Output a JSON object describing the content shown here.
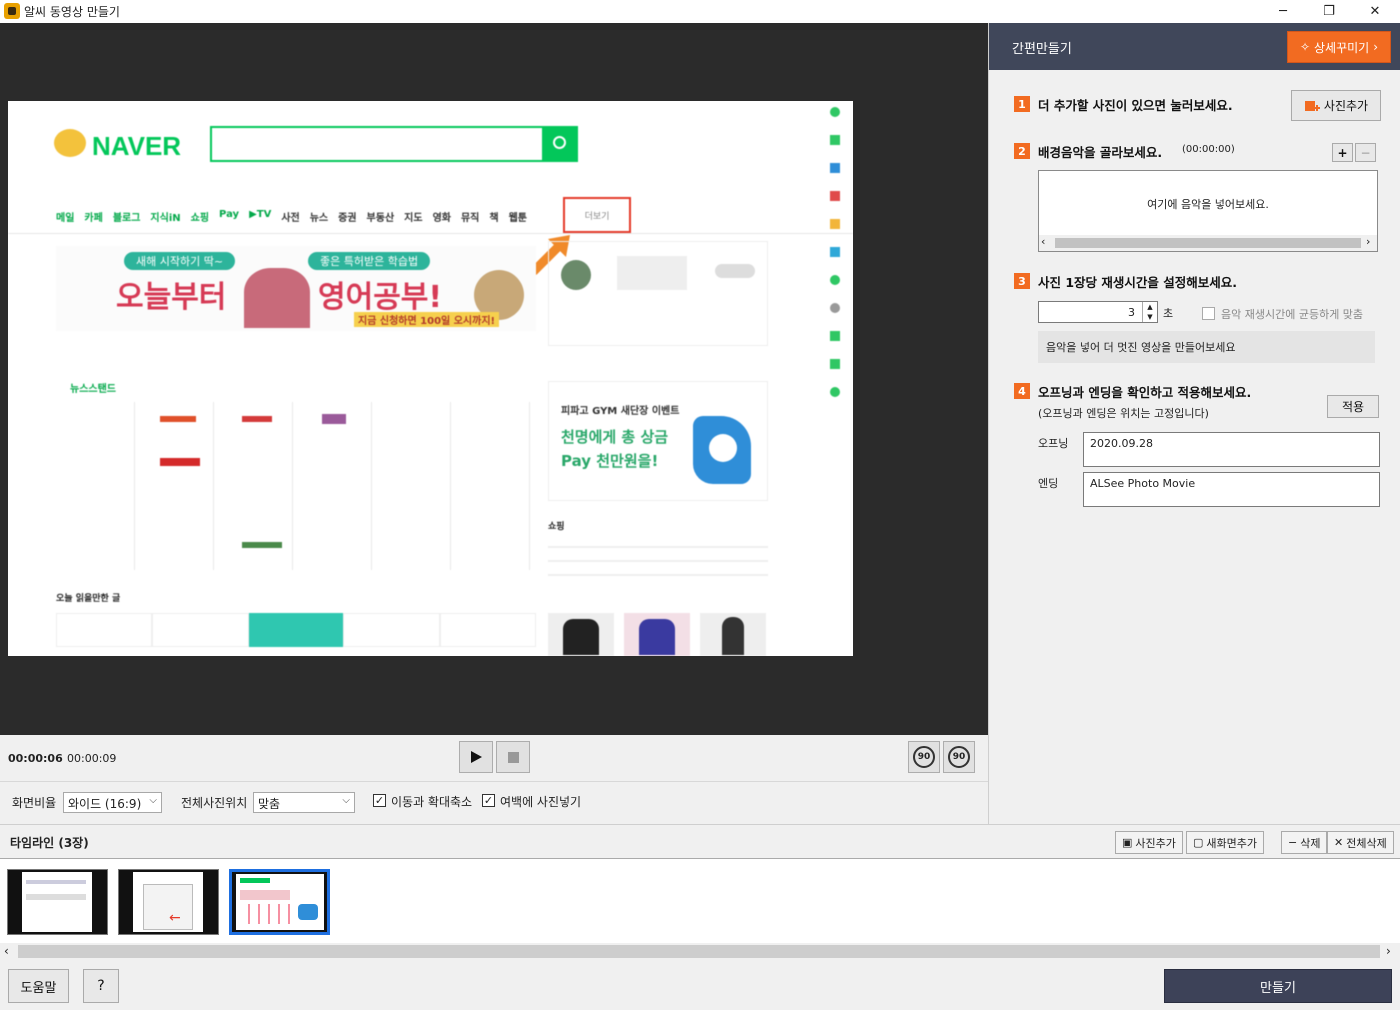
{
  "window": {
    "title": "알씨 동영상 만들기",
    "minimize_glyph": "─",
    "restore_glyph": "❐",
    "close_glyph": "✕"
  },
  "player": {
    "current_time": "00:00:06",
    "total_time": "00:00:09",
    "rotate_left_label": "90",
    "rotate_right_label": "90"
  },
  "options": {
    "aspect_label": "화면비율",
    "aspect_value": "와이드 (16:9)",
    "position_label": "전체사진위치",
    "position_value": "맞춤",
    "pan_zoom_label": "이동과 확대축소",
    "pan_zoom_checked": "✓",
    "fill_blank_label": "여백에 사진넣기",
    "fill_blank_checked": "✓"
  },
  "right_panel": {
    "title": "간편만들기",
    "detail_button": "상세꾸미기",
    "step1": {
      "num": "1",
      "text": "더 추가할 사진이 있으면 눌러보세요.",
      "button": "사진추가"
    },
    "step2": {
      "num": "2",
      "text": "배경음악을 골라보세요.",
      "duration": "(00:00:00)",
      "add": "+",
      "remove": "−",
      "placeholder": "여기에 음악을 넣어보세요."
    },
    "step3": {
      "num": "3",
      "text": "사진 1장당 재생시간을 설정해보세요.",
      "value": "3",
      "unit": "초",
      "equal_label": "음악 재생시간에 균등하게 맞춤",
      "hint": "음악을 넣어 더 멋진 영상을 만들어보세요"
    },
    "step4": {
      "num": "4",
      "text": "오프닝과 엔딩을 확인하고 적용해보세요.",
      "subtext": "(오프닝과 엔딩은 위치는 고정입니다)",
      "apply": "적용",
      "opening_label": "오프닝",
      "opening_value": "2020.09.28",
      "ending_label": "엔딩",
      "ending_value": "ALSee Photo Movie"
    }
  },
  "timeline": {
    "title": "타임라인 (3장)",
    "add_photo": "사진추가",
    "new_screen": "새화면추가",
    "delete": "삭제",
    "delete_all": "전체삭제",
    "selected_index": 3
  },
  "bottom": {
    "help": "도움말",
    "question": "?",
    "make": "만들기"
  },
  "screenshot": {
    "logo": "NAVER",
    "more": "더보기",
    "banner_left": "오늘부터",
    "banner_right": "영어공부!",
    "banner_tag": "새해 시작하기 딱~",
    "banner_tag2": "좋은 특허받은 학습법",
    "banner_sub": "지금 신청하면 100일 오시까지!",
    "news_title": "뉴스스탠드",
    "ad_title": "피파고 GYM 새단장 이벤트",
    "ad_line1": "천명에게 총 상금",
    "ad_line2": "Pay 천만원을!",
    "shopping": "쇼핑",
    "today": "오늘 읽을만한 글",
    "categories": [
      "메일",
      "카페",
      "블로그",
      "지식iN",
      "쇼핑",
      "Pay",
      "▶TV",
      "사전",
      "뉴스",
      "증권",
      "부동산",
      "지도",
      "영화",
      "뮤직",
      "책",
      "웹툰"
    ]
  },
  "colors": {
    "accent": "#f26b21",
    "header": "#40475a",
    "make_button": "#3d4258",
    "naver_green": "#03c75a",
    "highlight_red": "#e53a2a",
    "preview_bg": "#2b2b2b"
  }
}
